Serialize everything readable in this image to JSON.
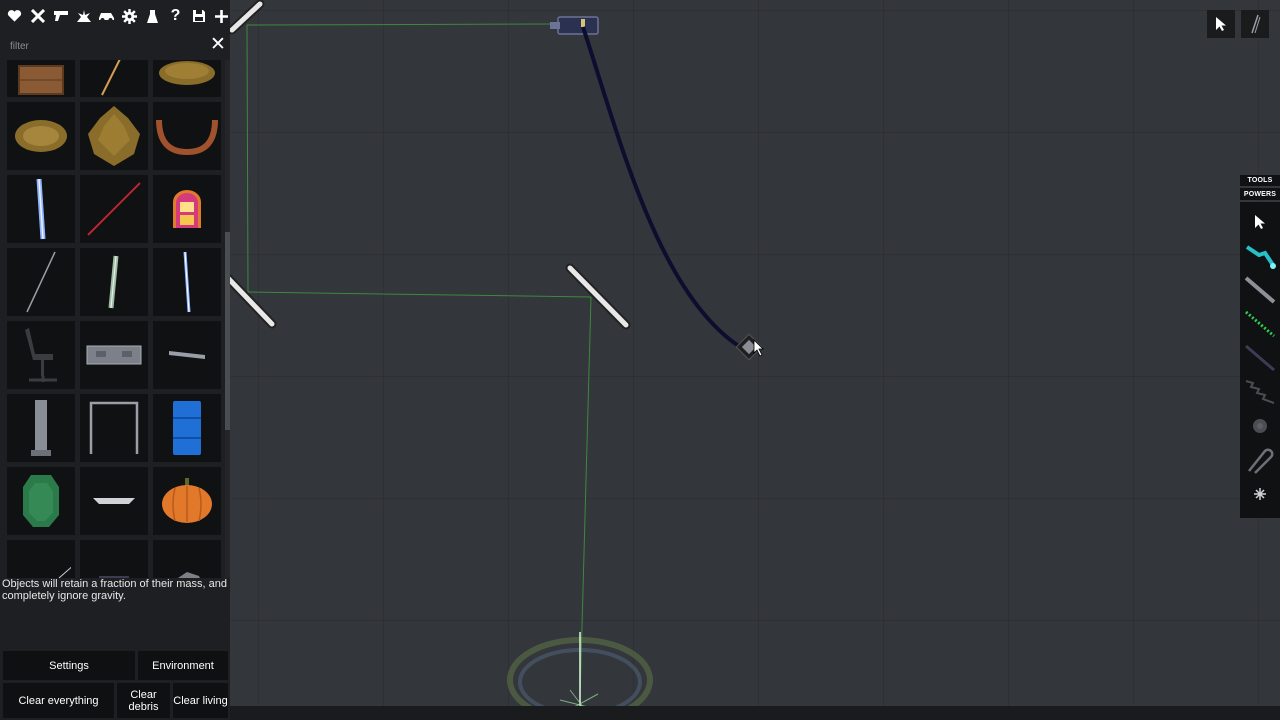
{
  "toolbar": {
    "buttons": [
      {
        "name": "favorites-button",
        "icon": "heart-icon"
      },
      {
        "name": "tools-button",
        "icon": "crossed-tools-icon"
      },
      {
        "name": "firearms-button",
        "icon": "gun-icon"
      },
      {
        "name": "explosives-button",
        "icon": "explosion-icon"
      },
      {
        "name": "vehicles-button",
        "icon": "car-icon"
      },
      {
        "name": "machinery-button",
        "icon": "gear-icon"
      },
      {
        "name": "chemistry-button",
        "icon": "flask-icon"
      },
      {
        "name": "misc-button",
        "icon": "question-icon"
      },
      {
        "name": "save-button",
        "icon": "floppy-disk-icon"
      },
      {
        "name": "add-button",
        "icon": "plus-icon"
      }
    ]
  },
  "filter": {
    "placeholder": "filter",
    "value": ""
  },
  "catalog": {
    "items": [
      "wooden-crate",
      "wooden-stick",
      "hay-pile",
      "hay-pile-small",
      "bush",
      "wooden-arch",
      "blue-fluorescent-tube",
      "red-rod",
      "jukebox",
      "thin-rod",
      "glass-tube",
      "blue-rod",
      "office-chair",
      "grey-panel",
      "grey-bench",
      "grey-cabinet",
      "metal-frame",
      "blue-barrel",
      "green-vase",
      "ceiling-lamp",
      "pumpkin",
      "wire",
      "dark-box",
      "rock"
    ]
  },
  "description": "Objects will retain a fraction of their mass, and completely ignore gravity.",
  "buttons": {
    "settings": "Settings",
    "environment": "Environment",
    "clear_everything": "Clear everything",
    "clear_debris": "Clear debris",
    "clear_living": "Clear living"
  },
  "right_panel": {
    "tools_label": "TOOLS",
    "powers_label": "POWERS",
    "tools": [
      "pointer-icon",
      "laser-tool-icon",
      "rod-tool-icon",
      "green-line-tool-icon",
      "dotted-tool-icon",
      "spring-tool-icon",
      "gear-tool-icon",
      "hook-tool-icon",
      "spark-tool-icon"
    ]
  },
  "top_right": {
    "buttons": [
      "select-cursor-icon",
      "drag-line-icon"
    ]
  },
  "colors": {
    "background": "#33363b",
    "panel": "#1d1f22",
    "cell": "#101113",
    "laser": "#3fae3f",
    "rope": "#0d0d2e"
  }
}
